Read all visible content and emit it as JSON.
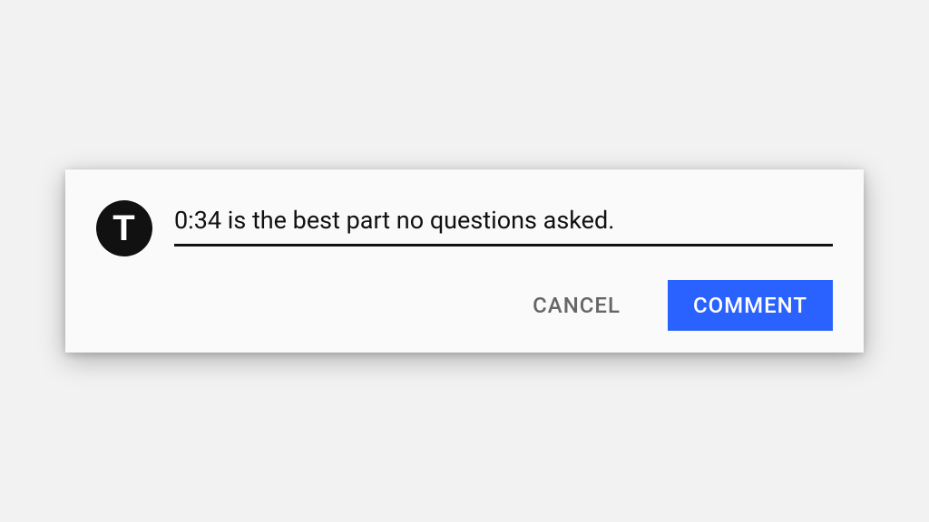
{
  "avatar": {
    "initial": "T"
  },
  "comment_input": {
    "value": "0:34 is the best part no questions asked."
  },
  "actions": {
    "cancel": "Cancel",
    "submit": "Comment"
  },
  "colors": {
    "submit_bg": "#2962ff",
    "text": "#111111",
    "cancel_text": "#666666"
  }
}
